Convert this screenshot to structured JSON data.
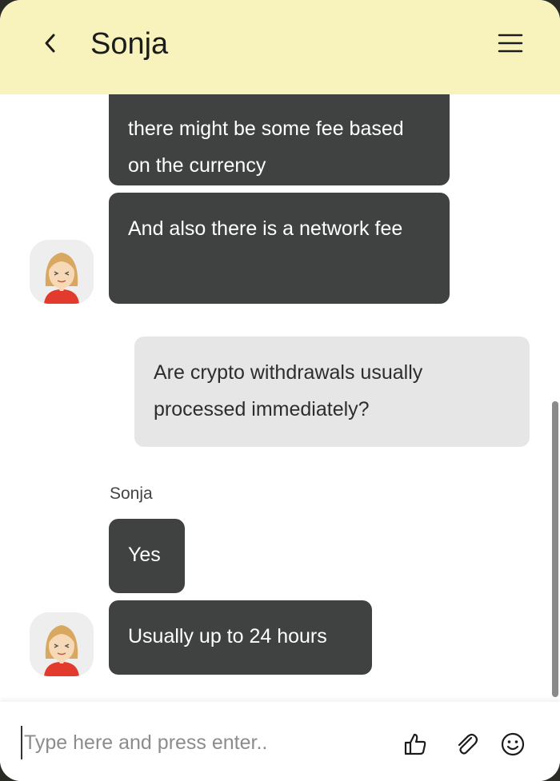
{
  "header": {
    "title": "Sonja",
    "back_icon": "chevron-left-icon",
    "menu_icon": "hamburger-menu-icon",
    "background": "#f8f3bd"
  },
  "messages": [
    {
      "from": "agent",
      "text": "there might be some fee based on the currency"
    },
    {
      "from": "agent",
      "text": "And also there is a network fee"
    },
    {
      "from": "user",
      "text": "Are crypto withdrawals usually processed immediately?"
    },
    {
      "from": "agent",
      "sender": "Sonja",
      "text": "Yes"
    },
    {
      "from": "agent",
      "text": "Usually up to 24 hours"
    }
  ],
  "composer": {
    "placeholder": "Type here and press enter..",
    "value": "",
    "icons": [
      "thumbs-up-icon",
      "paperclip-icon",
      "smiley-icon"
    ]
  },
  "colors": {
    "agent_bubble": "#404241",
    "user_bubble": "#e6e6e6"
  }
}
